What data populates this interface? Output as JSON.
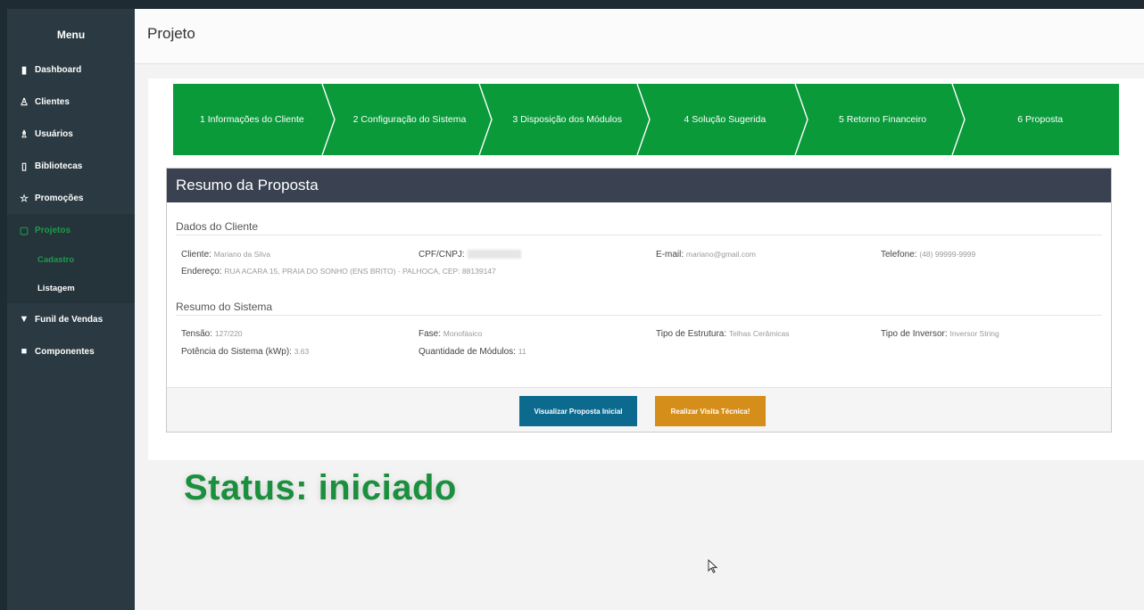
{
  "sidebar": {
    "title": "Menu",
    "items": [
      {
        "label": "Dashboard",
        "icon": "bar-chart-icon"
      },
      {
        "label": "Clientes",
        "icon": "user-icon"
      },
      {
        "label": "Usuários",
        "icon": "users-icon"
      },
      {
        "label": "Bibliotecas",
        "icon": "book-icon"
      },
      {
        "label": "Promoções",
        "icon": "star-icon"
      },
      {
        "label": "Projetos",
        "icon": "folder-icon"
      }
    ],
    "sub_items": [
      {
        "label": "Cadastro"
      },
      {
        "label": "Listagem"
      }
    ],
    "items_after": [
      {
        "label": "Funil de Vendas",
        "icon": "filter-icon"
      },
      {
        "label": "Componentes",
        "icon": "box-icon"
      }
    ]
  },
  "header": {
    "title": "Projeto"
  },
  "steps": [
    {
      "label": "1  Informações do Cliente"
    },
    {
      "label": "2  Configuração do Sistema"
    },
    {
      "label": "3  Disposição dos Módulos"
    },
    {
      "label": "4  Solução Sugerida"
    },
    {
      "label": "5  Retorno Financeiro"
    },
    {
      "label": "6  Proposta"
    }
  ],
  "summary": {
    "title": "Resumo da Proposta",
    "client_section": "Dados do Cliente",
    "client": {
      "label": "Cliente:",
      "value": "Mariano da Silva"
    },
    "cpf": {
      "label": "CPF/CNPJ:",
      "value": ""
    },
    "email": {
      "label": "E-mail:",
      "value": "mariano@gmail.com"
    },
    "phone": {
      "label": "Telefone:",
      "value": "(48) 99999-9999"
    },
    "address": {
      "label": "Endereço:",
      "value": "RUA ACARA 15, PRAIA DO SONHO (ENS BRITO) - PALHOCA, CEP: 88139147"
    },
    "system_section": "Resumo do Sistema",
    "voltage": {
      "label": "Tensão:",
      "value": "127/220"
    },
    "phase": {
      "label": "Fase:",
      "value": "Monofásico"
    },
    "structure": {
      "label": "Tipo de Estrutura:",
      "value": "Telhas Cerâmicas"
    },
    "inverter": {
      "label": "Tipo de Inversor:",
      "value": "Inversor String"
    },
    "power": {
      "label": "Potência do Sistema (kWp):",
      "value": "3.63"
    },
    "modules": {
      "label": "Quantidade de Módulos:",
      "value": "11"
    },
    "btn_view": "Visualizar Proposta Inicial",
    "btn_visit": "Realizar Visita Técnica!"
  },
  "status_text": "Status: iniciado",
  "colors": {
    "sidebar": "#2b3a42",
    "accent_green": "#0a9a3a",
    "header_dark": "#3a4150",
    "btn_blue": "#0c6a8f",
    "btn_orange": "#d68e1a"
  }
}
